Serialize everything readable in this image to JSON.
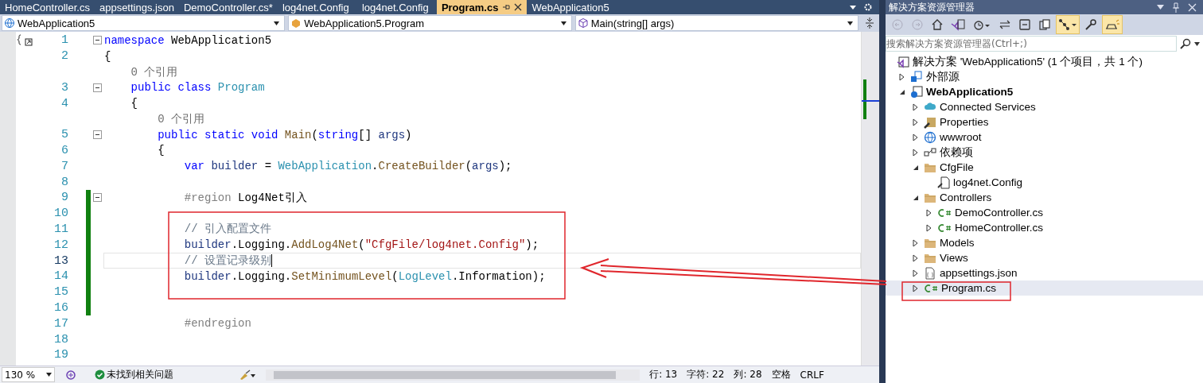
{
  "tabs": [
    {
      "label": "HomeController.cs",
      "selected": false
    },
    {
      "label": "appsettings.json",
      "selected": false
    },
    {
      "label": "DemoController.cs*",
      "selected": false
    },
    {
      "label": "log4net.Config",
      "selected": false
    },
    {
      "label": "log4net.Config",
      "selected": false
    },
    {
      "label": "Program.cs",
      "selected": true
    },
    {
      "label": "WebApplication5",
      "selected": false
    }
  ],
  "nav_bar": [
    {
      "kind": "project",
      "label": "WebApplication5"
    },
    {
      "kind": "class",
      "label": "WebApplication5.Program"
    },
    {
      "kind": "method",
      "label": "Main(string[] args)"
    }
  ],
  "editor": {
    "lines": [
      {
        "number": "1",
        "fold": true,
        "changed": false,
        "current": false,
        "tokens": [
          {
            "text": "namespace",
            "kind": "keyword"
          },
          {
            "text": " WebApplication5",
            "kind": "plain"
          }
        ]
      },
      {
        "number": "2",
        "fold": false,
        "changed": false,
        "current": false,
        "tokens": [
          {
            "text": "{",
            "kind": "plain"
          }
        ]
      },
      {
        "fold": false,
        "changed": false,
        "current": false,
        "tokens": [
          {
            "text": "    0 个引用",
            "kind": "lens"
          }
        ]
      },
      {
        "number": "3",
        "fold": true,
        "changed": false,
        "current": false,
        "tokens": [
          {
            "text": "    public class ",
            "kind": "keyword"
          },
          {
            "text": "Program",
            "kind": "type"
          }
        ]
      },
      {
        "number": "4",
        "fold": false,
        "changed": false,
        "current": false,
        "tokens": [
          {
            "text": "    {",
            "kind": "plain"
          }
        ]
      },
      {
        "fold": false,
        "changed": false,
        "current": false,
        "tokens": [
          {
            "text": "        0 个引用",
            "kind": "lens"
          }
        ]
      },
      {
        "number": "5",
        "fold": true,
        "changed": false,
        "current": false,
        "tokens": [
          {
            "text": "        public static void ",
            "kind": "keyword"
          },
          {
            "text": "Main",
            "kind": "method"
          },
          {
            "text": "(",
            "kind": "plain"
          },
          {
            "text": "string",
            "kind": "keyword"
          },
          {
            "text": "[] ",
            "kind": "plain"
          },
          {
            "text": "args",
            "kind": "param"
          },
          {
            "text": ")",
            "kind": "plain"
          }
        ]
      },
      {
        "number": "6",
        "fold": false,
        "changed": false,
        "current": false,
        "tokens": [
          {
            "text": "        {",
            "kind": "plain"
          }
        ]
      },
      {
        "number": "7",
        "fold": false,
        "changed": false,
        "current": false,
        "tokens": [
          {
            "text": "            var ",
            "kind": "keyword"
          },
          {
            "text": "builder",
            "kind": "param"
          },
          {
            "text": " = ",
            "kind": "plain"
          },
          {
            "text": "WebApplication",
            "kind": "type"
          },
          {
            "text": ".",
            "kind": "plain"
          },
          {
            "text": "CreateBuilder",
            "kind": "method"
          },
          {
            "text": "(",
            "kind": "plain"
          },
          {
            "text": "args",
            "kind": "param"
          },
          {
            "text": ");",
            "kind": "plain"
          }
        ]
      },
      {
        "number": "8",
        "fold": false,
        "changed": false,
        "current": false
      },
      {
        "number": "9",
        "fold": true,
        "changed": true,
        "current": false,
        "tokens": [
          {
            "text": "            #region",
            "kind": "preprocessor"
          },
          {
            "text": " Log4Net引入",
            "kind": "plain"
          }
        ]
      },
      {
        "number": "10",
        "fold": false,
        "changed": true,
        "current": false
      },
      {
        "number": "11",
        "fold": false,
        "changed": true,
        "current": false,
        "tokens": [
          {
            "text": "            // 引入配置文件",
            "kind": "comment"
          }
        ]
      },
      {
        "number": "12",
        "fold": false,
        "changed": true,
        "current": false,
        "tokens": [
          {
            "text": "            builder",
            "kind": "param"
          },
          {
            "text": ".Logging.",
            "kind": "plain"
          },
          {
            "text": "AddLog4Net",
            "kind": "method"
          },
          {
            "text": "(",
            "kind": "plain"
          },
          {
            "text": "\"CfgFile/log4net.Config\"",
            "kind": "string"
          },
          {
            "text": ");",
            "kind": "plain"
          }
        ]
      },
      {
        "number": "13",
        "fold": false,
        "changed": true,
        "current": true,
        "tokens": [
          {
            "text": "            // 设置记录级别",
            "kind": "comment"
          }
        ]
      },
      {
        "number": "14",
        "fold": false,
        "changed": true,
        "current": false,
        "tokens": [
          {
            "text": "            builder",
            "kind": "param"
          },
          {
            "text": ".Logging.",
            "kind": "plain"
          },
          {
            "text": "SetMinimumLevel",
            "kind": "method"
          },
          {
            "text": "(",
            "kind": "plain"
          },
          {
            "text": "LogLevel",
            "kind": "type"
          },
          {
            "text": ".Information);",
            "kind": "plain"
          }
        ]
      },
      {
        "number": "15",
        "fold": false,
        "changed": true,
        "current": false
      },
      {
        "number": "16",
        "fold": false,
        "changed": true,
        "current": false
      },
      {
        "number": "17",
        "fold": false,
        "changed": false,
        "current": false,
        "tokens": [
          {
            "text": "            #endregion",
            "kind": "preprocessor"
          }
        ]
      },
      {
        "number": "18",
        "fold": false,
        "changed": false,
        "current": false
      },
      {
        "number": "19",
        "fold": false,
        "changed": false,
        "current": false
      }
    ]
  },
  "status_bar": {
    "zoom": "130 %",
    "issues": "未找到相关问题",
    "line": "行: 13",
    "char": "字符: 22",
    "column": "列: 28",
    "indent": "空格",
    "line_ending": "CRLF"
  },
  "solution_explorer": {
    "title": "解决方案资源管理器",
    "toolbar": [
      {
        "kind": "back",
        "active": false
      },
      {
        "kind": "forward",
        "active": false
      },
      {
        "kind": "home",
        "active": false
      },
      {
        "kind": "switch-view",
        "active": false
      },
      {
        "kind": "history",
        "active": false
      },
      {
        "kind": "sync",
        "active": false
      },
      {
        "kind": "collapse",
        "active": false
      },
      {
        "kind": "copy",
        "active": false
      },
      {
        "kind": "tree-view",
        "active": true
      },
      {
        "kind": "properties",
        "active": false
      },
      {
        "kind": "preview",
        "active": true
      }
    ],
    "search": {
      "placeholder": "搜索解决方案资源管理器(Ctrl+;)"
    },
    "tree": [
      {
        "label": "解决方案 'WebApplication5' (1 个项目，共 1 个)",
        "kind": "solution",
        "selected": false
      },
      {
        "label": "外部源",
        "kind": "external",
        "expanded": false,
        "selected": false
      },
      {
        "label": "WebApplication5",
        "kind": "project",
        "expanded": true,
        "selected": false,
        "children": [
          {
            "label": "Connected Services",
            "kind": "cloud",
            "expanded": false,
            "selected": false
          },
          {
            "label": "Properties",
            "kind": "properties",
            "expanded": false,
            "selected": false
          },
          {
            "label": "wwwroot",
            "kind": "globe",
            "expanded": false,
            "selected": false
          },
          {
            "label": "依赖项",
            "kind": "dependencies",
            "expanded": false,
            "selected": false
          },
          {
            "label": "CfgFile",
            "kind": "folder",
            "expanded": true,
            "selected": false,
            "children": [
              {
                "label": "log4net.Config",
                "kind": "config",
                "selected": false
              }
            ]
          },
          {
            "label": "Controllers",
            "kind": "folder",
            "expanded": true,
            "selected": false,
            "children": [
              {
                "label": "DemoController.cs",
                "kind": "csharp",
                "expanded": false,
                "selected": false
              },
              {
                "label": "HomeController.cs",
                "kind": "csharp",
                "expanded": false,
                "selected": false
              }
            ]
          },
          {
            "label": "Models",
            "kind": "folder",
            "expanded": false,
            "selected": false
          },
          {
            "label": "Views",
            "kind": "folder",
            "expanded": false,
            "selected": false
          },
          {
            "label": "appsettings.json",
            "kind": "json",
            "expanded": false,
            "selected": false
          },
          {
            "label": "Program.cs",
            "kind": "csharp",
            "expanded": false,
            "selected": true
          }
        ]
      }
    ]
  }
}
